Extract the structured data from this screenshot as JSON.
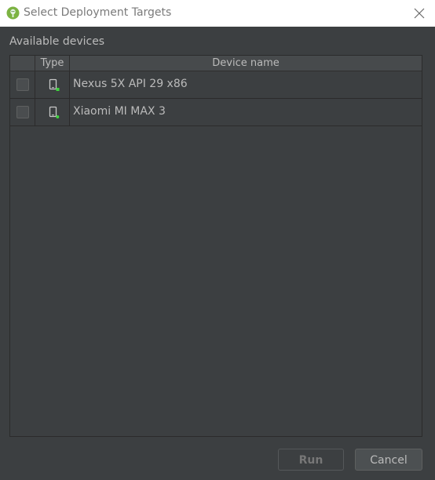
{
  "window": {
    "title": "Select Deployment Targets",
    "app_icon": "android-studio-icon",
    "close_icon": "close-icon"
  },
  "section": {
    "label": "Available devices"
  },
  "table": {
    "columns": [
      "",
      "Type",
      "Device name"
    ],
    "rows": [
      {
        "checked": false,
        "type_icon": "phone-device-icon",
        "name": "Nexus 5X API 29 x86"
      },
      {
        "checked": false,
        "type_icon": "phone-device-icon",
        "name": "Xiaomi MI MAX 3"
      }
    ]
  },
  "buttons": {
    "run_label": "Run",
    "run_enabled": false,
    "cancel_label": "Cancel"
  },
  "colors": {
    "background": "#3c3f41",
    "titlebar": "#ffffff",
    "text": "#bbbbbb",
    "status_online": "#3fd43f",
    "android_green": "#7cb342"
  }
}
